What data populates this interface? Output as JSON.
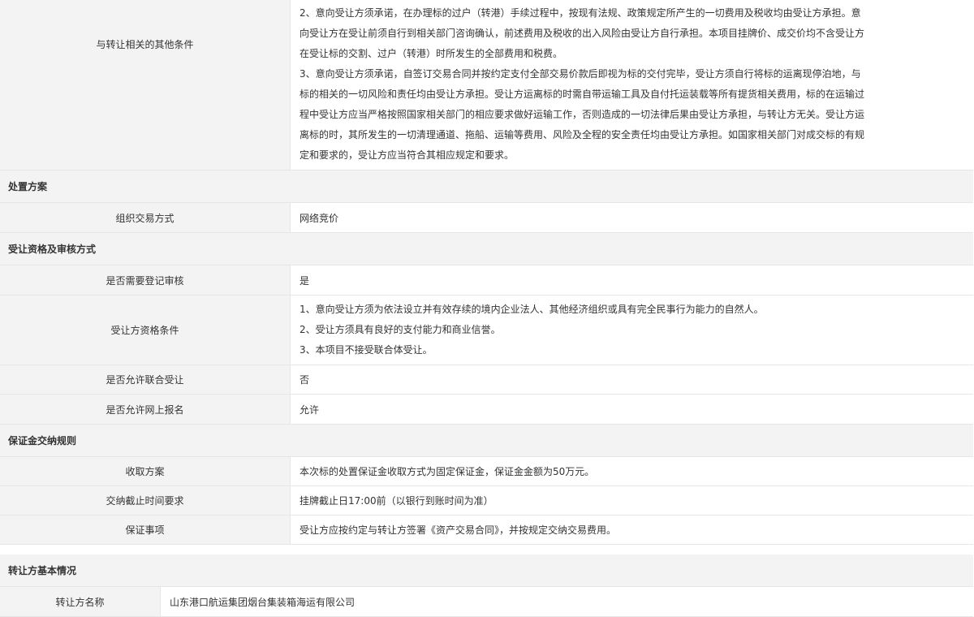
{
  "other_conditions": {
    "label": "与转让相关的其他条件",
    "lines": [
      "2、意向受让方须承诺，在办理标的过户（转港）手续过程中，按现有法规、政策规定所产生的一切费用及税收均由受让方承担。意",
      "向受让方在受让前须自行到相关部门咨询确认，前述费用及税收的出入风险由受让方自行承担。本项目挂牌价、成交价均不含受让方",
      "在受让标的交割、过户（转港）时所发生的全部费用和税费。",
      "3、意向受让方须承诺，自签订交易合同并按约定支付全部交易价款后即视为标的交付完毕，受让方须自行将标的运离现停泊地，与",
      "标的相关的一切风险和责任均由受让方承担。受让方运离标的时需自带运输工具及自付托运装载等所有提货相关费用，标的在运输过",
      "程中受让方应当严格按照国家相关部门的相应要求做好运输工作，否则造成的一切法律后果由受让方承担，与转让方无关。受让方运",
      "离标的时，其所发生的一切清理通道、拖船、运输等费用、风险及全程的安全责任均由受让方承担。如国家相关部门对成交标的有规",
      "定和要求的，受让方应当符合其相应规定和要求。"
    ]
  },
  "disposal": {
    "section_title": "处置方案",
    "method_label": "组织交易方式",
    "method_value": "网络竞价"
  },
  "qualification": {
    "section_title": "受让资格及审核方式",
    "register_label": "是否需要登记审核",
    "register_value": "是",
    "conditions_label": "受让方资格条件",
    "conditions_lines": [
      "1、意向受让方须为依法设立并有效存续的境内企业法人、其他经济组织或具有完全民事行为能力的自然人。",
      "2、受让方须具有良好的支付能力和商业信誉。",
      "3、本项目不接受联合体受让。"
    ],
    "joint_label": "是否允许联合受让",
    "joint_value": "否",
    "online_label": "是否允许网上报名",
    "online_value": "允许"
  },
  "deposit": {
    "section_title": "保证金交纳规则",
    "plan_label": "收取方案",
    "plan_value": "本次标的处置保证金收取方式为固定保证金，保证金金额为50万元。",
    "deadline_label": "交纳截止时间要求",
    "deadline_value": "挂牌截止日17:00前（以银行到账时间为准）",
    "matters_label": "保证事项",
    "matters_value": "受让方应按约定与转让方签署《资产交易合同》，并按规定交纳交易费用。"
  },
  "transferor": {
    "section_title": "转让方基本情况",
    "name_label": "转让方名称",
    "name_value": "山东港口航运集团烟台集装箱海运有限公司"
  }
}
